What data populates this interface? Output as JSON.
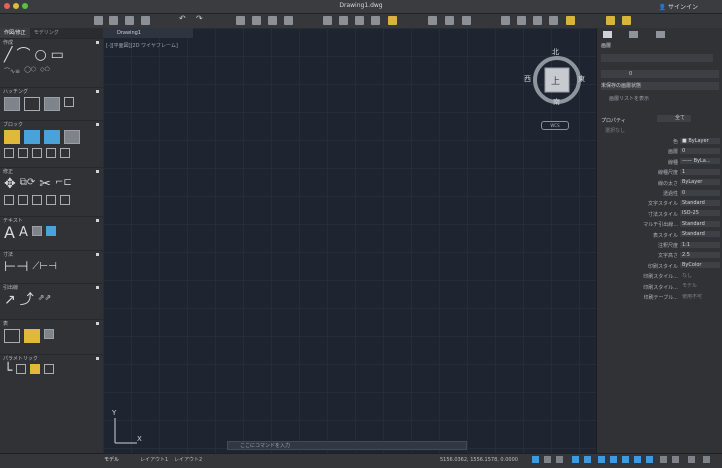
{
  "window": {
    "title": "Drawing1.dwg",
    "user": "サインイン"
  },
  "colors": {
    "accent": "#3c9be0",
    "canvas": "#1f2530",
    "panel": "#303236"
  },
  "palette": {
    "tabs": [
      "作図/修正",
      "モデリング"
    ],
    "sections": [
      "作成",
      "ハッチング",
      "ブロック",
      "修正",
      "テキスト",
      "寸法",
      "引出線",
      "表",
      "パラメトリック"
    ]
  },
  "document": {
    "tab_label": "Drawing1"
  },
  "viewport": {
    "label": "[-][平面図][2D ワイヤフレーム]",
    "wcs": "WCS"
  },
  "compass": {
    "north": "北",
    "south": "南",
    "east": "東",
    "west": "西",
    "top": "上"
  },
  "axes": {
    "x": "X",
    "y": "Y"
  },
  "command": {
    "placeholder": "ここにコマンドを入力"
  },
  "layers": {
    "header": "画層",
    "current": "0",
    "state": "未保存の画層状態",
    "list_btn": "画層リストを表示"
  },
  "properties": {
    "header": "プロパティ",
    "subheader": "選択なし",
    "filter": "全て",
    "rows": [
      {
        "label": "色",
        "value": "■ ByLayer"
      },
      {
        "label": "画層",
        "value": "0"
      },
      {
        "label": "線種",
        "value": "—— ByLa..."
      },
      {
        "label": "線種尺度",
        "value": "1"
      },
      {
        "label": "線の太さ",
        "value": "ByLayer"
      },
      {
        "label": "透過性",
        "value": "0"
      },
      {
        "label": "文字スタイル",
        "value": "Standard"
      },
      {
        "label": "寸法スタイル",
        "value": "ISO-25"
      },
      {
        "label": "マルチ引出線...",
        "value": "Standard"
      },
      {
        "label": "表スタイル",
        "value": "Standard"
      },
      {
        "label": "注釈尺度",
        "value": "1:1"
      },
      {
        "label": "文字高さ",
        "value": "2.5"
      },
      {
        "label": "印刷スタイル",
        "value": "ByColor"
      },
      {
        "label": "印刷スタイル...",
        "value": "なし"
      },
      {
        "label": "印刷スタイル...",
        "value": "モデル"
      },
      {
        "label": "印刷テーブル...",
        "value": "使用不可"
      }
    ]
  },
  "status": {
    "model_tab": "モデル",
    "layout_tabs": [
      "レイアウト1",
      "レイアウト2"
    ],
    "coords": "5156.0362, 1556.1578, 0.0000"
  }
}
